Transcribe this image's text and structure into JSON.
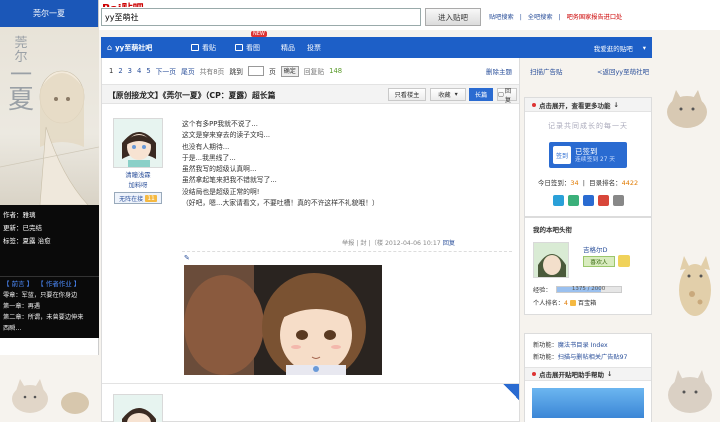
{
  "left_panel": {
    "title": "莞尔一夏",
    "art_text": [
      "莞",
      "尔",
      "一",
      "夏"
    ],
    "meta": [
      {
        "label": "作者：",
        "value": "雅璃"
      },
      {
        "label": "更新：",
        "value": "已完结"
      },
      {
        "label": "标签：",
        "value": "夏露 治愈"
      }
    ],
    "tabs": [
      "【 前言 】",
      "【 作者作业 】"
    ],
    "chapters": [
      "零章：军蓝，只要在你身边",
      "第一章：再遇",
      "第二章：所谓，未曾要边伸来",
      "西瞬…"
    ]
  },
  "topbar": {
    "logo": "Bai贴吧",
    "search_value": "yy至萌社",
    "search_button": "进入贴吧",
    "links": [
      "贴吧搜索",
      "全吧搜索"
    ],
    "link_red": "吧务国家报告进口处"
  },
  "nav": {
    "forum": "yy至萌社吧",
    "items": [
      "看贴",
      "看图",
      "精品",
      "投票"
    ],
    "new_badge": "NEW",
    "right": "我爱逛的贴吧"
  },
  "pager": {
    "pages": [
      "1",
      "2",
      "3",
      "4",
      "5"
    ],
    "next": "下一页",
    "last": "尾页",
    "total": "共有8页",
    "jump": "跳到",
    "page_unit": "页",
    "go": "确定",
    "reply_label": "回复贴",
    "reply_count": "148",
    "delete": "删除主题"
  },
  "thread": {
    "title": "【原创接龙文】《莞尔一夏》（CP：夏露）超长篇",
    "btn_author_only": "只看楼主",
    "btn_favorite": "收藏",
    "btn_longpic": "长篇",
    "btn_reply": "回复"
  },
  "post": {
    "author_name": "清瞳浅霖",
    "author_grade": "加料呀",
    "author_level": "无阵在接",
    "author_level_num": "11",
    "lines": [
      "这个有多PP我就不说了...",
      "这文是穿来穿去的读子文吗...",
      "也没有人期待...",
      "于是...我黑线了...",
      "虽然我写的超级认真啊...",
      "虽然拿起笔来把我不错就写了...",
      "没结局也是超级正常的啊!",
      "（好吧，嗯...大家请看文，不要吐槽！真的不许这样不礼貌哦！）"
    ],
    "meta_report": "举报",
    "meta_sep": "|",
    "meta_floor": "封",
    "meta_time": "|（楼 2012-04-06 10:17",
    "meta_reply": "回复"
  },
  "right": {
    "ad_label": "扫描广告贴",
    "back_link": "<返回yy至萌社吧",
    "sign_header": "点击展开，查看更多功能",
    "sign_art": "记录共同成长的每一天",
    "sign_btn_main": "已签到",
    "sign_btn_sub": "连续签到 27 天",
    "sign_cal": "签到",
    "sign_today_label": "今日签到：",
    "sign_today": "34",
    "sign_rank_label": "目录排名：",
    "sign_rank": "4422",
    "user_title": "我的本吧头衔",
    "user_name": "吉格尔D",
    "user_follow": "喜欢人",
    "exp_label": "经验：",
    "exp_value": "1375 / 2000",
    "exp_fraction": 0.6875,
    "badge_label": "个人排名：",
    "badge_rank": "4",
    "badge_name": "百宝箱",
    "news1_label": "新功能：",
    "news1": "魔法书目录 Index",
    "news2_label": "新功能：",
    "news2": "扫描与删帖相关广告贴97",
    "help_header": "点击展开贴吧助手帮助"
  }
}
